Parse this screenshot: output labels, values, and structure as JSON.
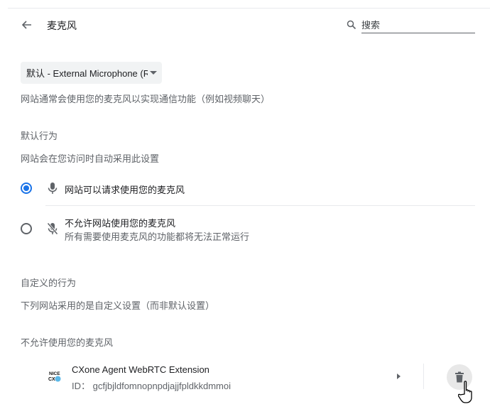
{
  "header": {
    "back_icon": "arrow-back-icon",
    "title": "麦克风",
    "search_icon": "search-icon",
    "search_placeholder": "搜索",
    "search_value": ""
  },
  "device_select": {
    "selected": "默认 - External Microphone (R",
    "caret_icon": "caret-down-icon"
  },
  "description": "网站通常会使用您的麦克风以实现通信功能（例如视频聊天）",
  "default_behavior": {
    "heading": "默认行为",
    "subheading": "网站会在您访问时自动采用此设置",
    "options": [
      {
        "label": "网站可以请求使用您的麦克风",
        "sublabel": "",
        "icon": "mic-icon",
        "selected": true
      },
      {
        "label": "不允许网站使用您的麦克风",
        "sublabel": "所有需要使用麦克风的功能都将无法正常运行",
        "icon": "mic-off-icon",
        "selected": false
      }
    ],
    "accent_color": "#1a73e8"
  },
  "custom_behavior": {
    "heading": "自定义的行为",
    "subheading": "下列网站采用的是自定义设置（而非默认设置）",
    "blocked_heading": "不允许使用您的麦克风",
    "sites": [
      {
        "name": "CXone Agent WebRTC Extension",
        "id_label": "ID：",
        "id_value": "gcfjbjldfomnopnpdjajjfpldkkdmmoi",
        "id_text": "ID：  gcfjbjldfomnopnpdjajjfpldkkdmmoi",
        "favicon": "nice-cxone-icon",
        "expand_icon": "arrow-right-icon",
        "delete_icon": "trash-icon"
      }
    ]
  }
}
